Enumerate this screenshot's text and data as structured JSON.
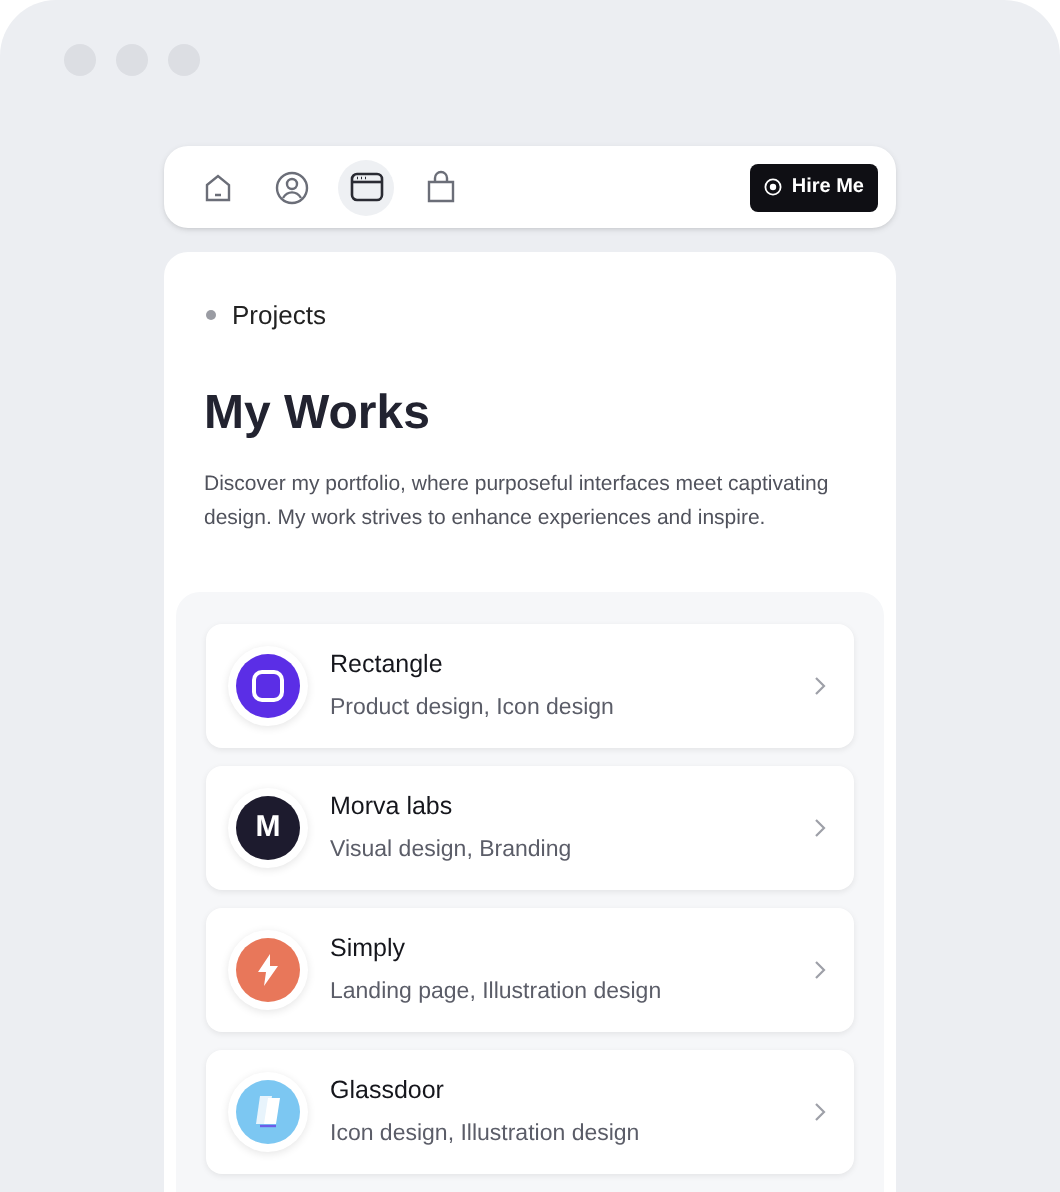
{
  "nav": {
    "items": [
      {
        "kind": "home",
        "selected": false
      },
      {
        "kind": "profile",
        "selected": false
      },
      {
        "kind": "browser",
        "selected": true
      },
      {
        "kind": "bag",
        "selected": false
      }
    ],
    "button": "Hire Me"
  },
  "breadcrumb": "Projects",
  "title": "My Works",
  "intro": "Discover my portfolio, where purposeful interfaces meet captivating design. My work strives to enhance experiences and inspire.",
  "projects": [
    {
      "name": "Rectangle",
      "tags": "Product design, Icon design",
      "kind": "square",
      "color": "#5b2ee6"
    },
    {
      "name": "Morva labs",
      "tags": "Visual design, Branding",
      "kind": "letter",
      "logo_text": "M",
      "color": "#1d1b2e"
    },
    {
      "name": "Simply",
      "tags": "Landing page, Illustration design",
      "kind": "bolt",
      "color": "#e8775a"
    },
    {
      "name": "Glassdoor",
      "tags": "Icon design, Illustration design",
      "kind": "pages",
      "color": "#7cc7f2"
    }
  ]
}
